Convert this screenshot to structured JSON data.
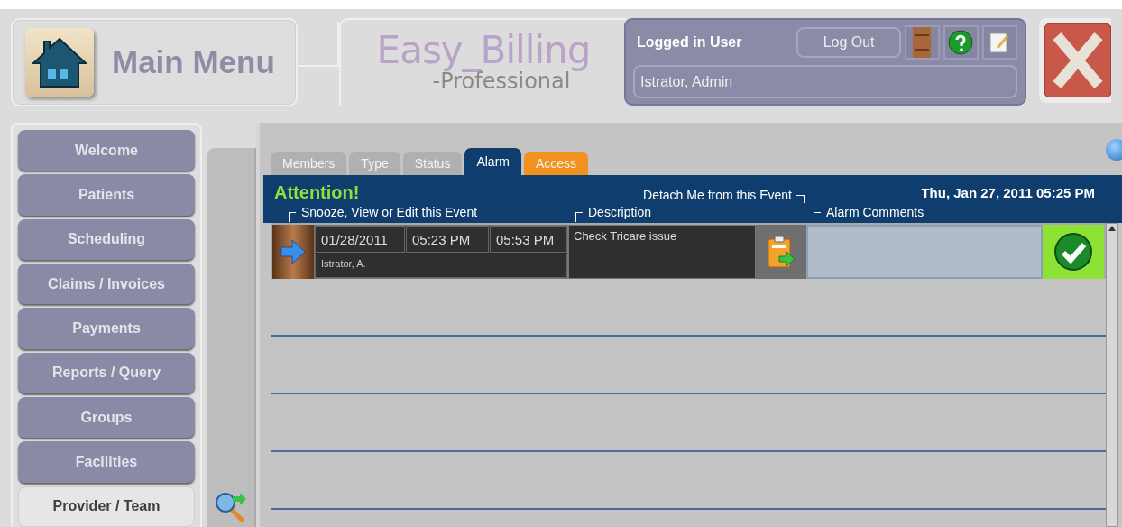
{
  "header": {
    "main_menu": "Main Menu",
    "logo": {
      "title": "Easy_Billing",
      "subtitle": "-Professional"
    },
    "user": {
      "label": "Logged in User",
      "logout": "Log Out",
      "name": "Istrator, Admin"
    }
  },
  "sidebar": {
    "items": [
      {
        "label": "Welcome",
        "selected": false
      },
      {
        "label": "Patients",
        "selected": false
      },
      {
        "label": "Scheduling",
        "selected": false
      },
      {
        "label": "Claims / Invoices",
        "selected": false
      },
      {
        "label": "Payments",
        "selected": false
      },
      {
        "label": "Reports / Query",
        "selected": false
      },
      {
        "label": "Groups",
        "selected": false
      },
      {
        "label": "Facilities",
        "selected": false
      },
      {
        "label": "Provider / Team",
        "selected": true
      }
    ]
  },
  "tabs": [
    {
      "label": "Members",
      "selected": false,
      "kind": "plain"
    },
    {
      "label": "Type",
      "selected": false,
      "kind": "plain"
    },
    {
      "label": "Status",
      "selected": false,
      "kind": "plain"
    },
    {
      "label": "Alarm",
      "selected": true,
      "kind": "plain"
    },
    {
      "label": "Access",
      "selected": false,
      "kind": "accent"
    }
  ],
  "alarm": {
    "attention": "Attention!",
    "detach_label": "Detach Me from this Event",
    "datetime": "Thu, Jan 27, 2011 05:25 PM",
    "columns": [
      "Snooze, View or Edit this Event",
      "Description",
      "Alarm Comments"
    ],
    "rows": [
      {
        "date": "01/28/2011",
        "start": "05:23 PM",
        "end": "05:53 PM",
        "owner": "Istrator, A.",
        "description": "Check Tricare issue"
      }
    ]
  }
}
